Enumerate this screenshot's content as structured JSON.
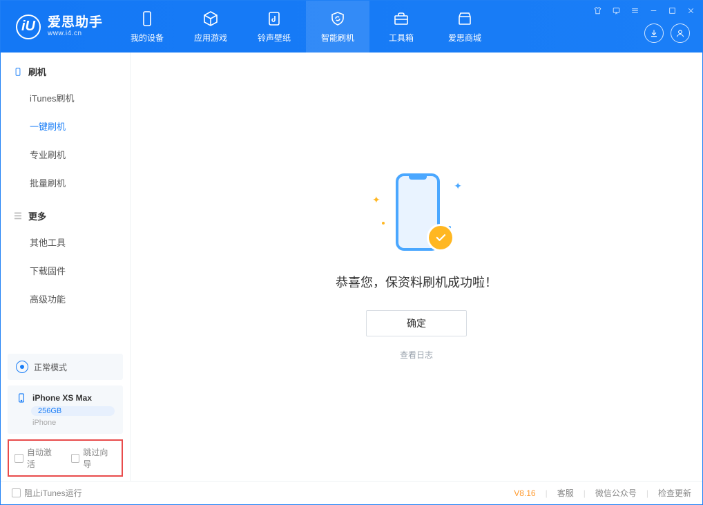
{
  "app": {
    "name_cn": "爱思助手",
    "url": "www.i4.cn"
  },
  "tabs": [
    {
      "label": "我的设备"
    },
    {
      "label": "应用游戏"
    },
    {
      "label": "铃声壁纸"
    },
    {
      "label": "智能刷机"
    },
    {
      "label": "工具箱"
    },
    {
      "label": "爱思商城"
    }
  ],
  "sidebar": {
    "section_flash": "刷机",
    "items_flash": [
      "iTunes刷机",
      "一键刷机",
      "专业刷机",
      "批量刷机"
    ],
    "section_more": "更多",
    "items_more": [
      "其他工具",
      "下载固件",
      "高级功能"
    ]
  },
  "status": {
    "mode": "正常模式"
  },
  "device": {
    "name": "iPhone XS Max",
    "storage": "256GB",
    "type": "iPhone"
  },
  "options": {
    "auto_activate": "自动激活",
    "skip_guide": "跳过向导"
  },
  "main": {
    "success_msg": "恭喜您，保资料刷机成功啦！",
    "ok": "确定",
    "view_log": "查看日志"
  },
  "footer": {
    "block_itunes": "阻止iTunes运行",
    "version": "V8.16",
    "support": "客服",
    "wechat": "微信公众号",
    "check_update": "检查更新"
  }
}
